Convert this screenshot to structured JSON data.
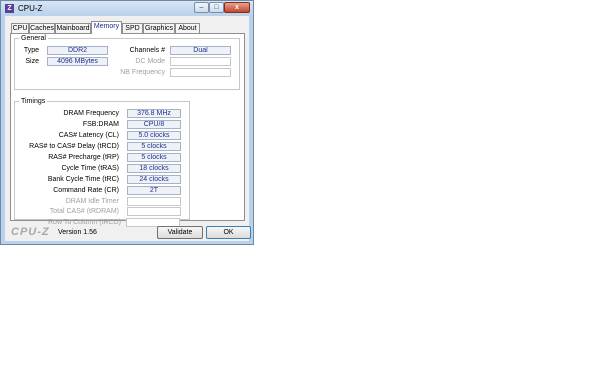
{
  "window": {
    "title": "CPU-Z",
    "icon_letter": "Z",
    "minimize": "–",
    "maximize": "□",
    "close": "x"
  },
  "tabs": [
    {
      "label": "CPU"
    },
    {
      "label": "Caches"
    },
    {
      "label": "Mainboard"
    },
    {
      "label": "Memory"
    },
    {
      "label": "SPD"
    },
    {
      "label": "Graphics"
    },
    {
      "label": "About"
    }
  ],
  "active_tab": "Memory",
  "general": {
    "title": "General",
    "type_label": "Type",
    "type_value": "DDR2",
    "size_label": "Size",
    "size_value": "4096 MBytes",
    "channels_label": "Channels #",
    "channels_value": "Dual",
    "dc_mode_label": "DC Mode",
    "dc_mode_value": "",
    "nb_freq_label": "NB Frequency",
    "nb_freq_value": ""
  },
  "timings": {
    "title": "Timings",
    "rows": [
      {
        "label": "DRAM Frequency",
        "value": "376.8 MHz",
        "enabled": true
      },
      {
        "label": "FSB:DRAM",
        "value": "CPU/8",
        "enabled": true
      },
      {
        "label": "CAS# Latency (CL)",
        "value": "5.0 clocks",
        "enabled": true
      },
      {
        "label": "RAS# to CAS# Delay (tRCD)",
        "value": "5 clocks",
        "enabled": true
      },
      {
        "label": "RAS# Precharge (tRP)",
        "value": "5 clocks",
        "enabled": true
      },
      {
        "label": "Cycle Time (tRAS)",
        "value": "18 clocks",
        "enabled": true
      },
      {
        "label": "Bank Cycle Time (tRC)",
        "value": "24 clocks",
        "enabled": true
      },
      {
        "label": "Command Rate (CR)",
        "value": "2T",
        "enabled": true
      },
      {
        "label": "DRAM Idle Timer",
        "value": "",
        "enabled": false
      },
      {
        "label": "Total CAS# (tRDRAM)",
        "value": "",
        "enabled": false
      },
      {
        "label": "Row To Column (tRCD)",
        "value": "",
        "enabled": false
      }
    ]
  },
  "footer": {
    "logo": "CPU-Z",
    "version": "Version 1.56",
    "validate": "Validate",
    "ok": "OK"
  }
}
